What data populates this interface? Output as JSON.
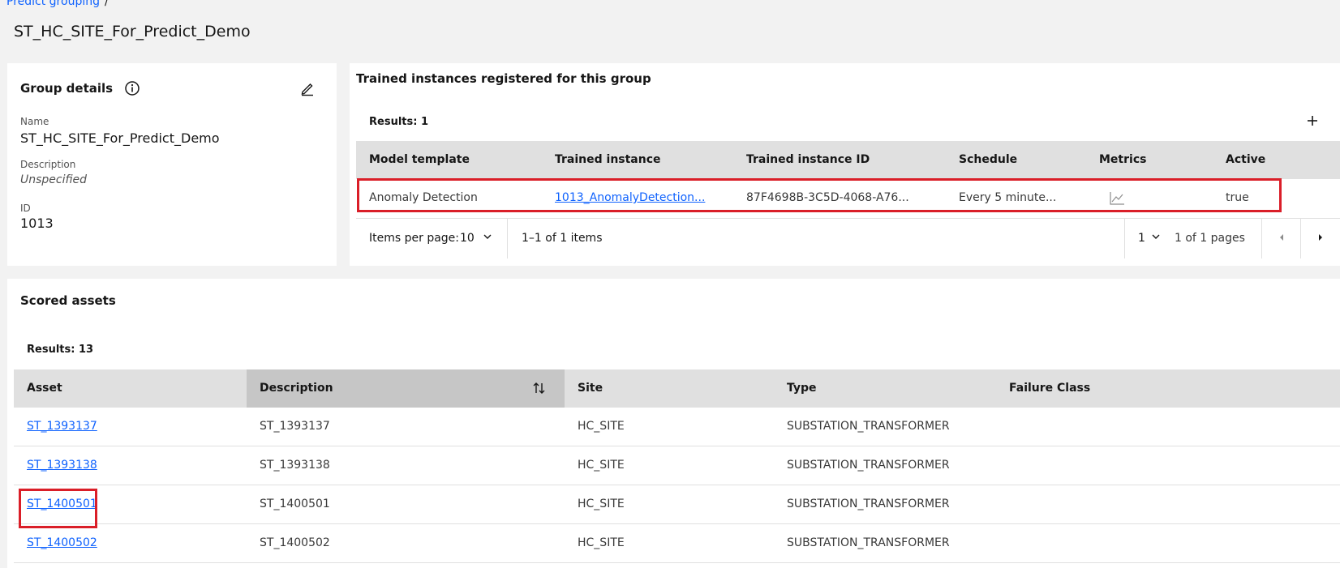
{
  "breadcrumb": {
    "link": "Predict grouping",
    "separator": "/"
  },
  "page_title": "ST_HC_SITE_For_Predict_Demo",
  "group_details": {
    "title": "Group details",
    "name_label": "Name",
    "name_value": "ST_HC_SITE_For_Predict_Demo",
    "description_label": "Description",
    "description_value": "Unspecified",
    "id_label": "ID",
    "id_value": "1013"
  },
  "trained_instances": {
    "title": "Trained instances registered for this group",
    "results": "Results: 1",
    "columns": [
      "Model template",
      "Trained instance",
      "Trained instance ID",
      "Schedule",
      "Metrics",
      "Active"
    ],
    "rows": [
      {
        "model_template": "Anomaly Detection",
        "trained_instance": "1013_AnomalyDetection...",
        "trained_instance_id": "87F4698B-3C5D-4068-A76...",
        "schedule": "Every 5 minute...",
        "active": "true"
      }
    ],
    "pagination": {
      "items_per_page_label": "Items per page:",
      "items_per_page_value": "10",
      "range": "1–1 of 1 items",
      "page_value": "1",
      "pages_text": "1 of 1 pages"
    }
  },
  "scored_assets": {
    "title": "Scored assets",
    "results": "Results: 13",
    "columns": [
      "Asset",
      "Description",
      "Site",
      "Type",
      "Failure Class"
    ],
    "rows": [
      {
        "asset": "ST_1393137",
        "description": "ST_1393137",
        "site": "HC_SITE",
        "type": "SUBSTATION_TRANSFORMER",
        "failure_class": ""
      },
      {
        "asset": "ST_1393138",
        "description": "ST_1393138",
        "site": "HC_SITE",
        "type": "SUBSTATION_TRANSFORMER",
        "failure_class": ""
      },
      {
        "asset": "ST_1400501",
        "description": "ST_1400501",
        "site": "HC_SITE",
        "type": "SUBSTATION_TRANSFORMER",
        "failure_class": ""
      },
      {
        "asset": "ST_1400502",
        "description": "ST_1400502",
        "site": "HC_SITE",
        "type": "SUBSTATION_TRANSFORMER",
        "failure_class": ""
      }
    ]
  },
  "colors": {
    "link": "#0f62fe",
    "highlight": "#da1e28",
    "header_bg": "#e0e0e0",
    "sorted_header_bg": "#c6c6c6"
  }
}
